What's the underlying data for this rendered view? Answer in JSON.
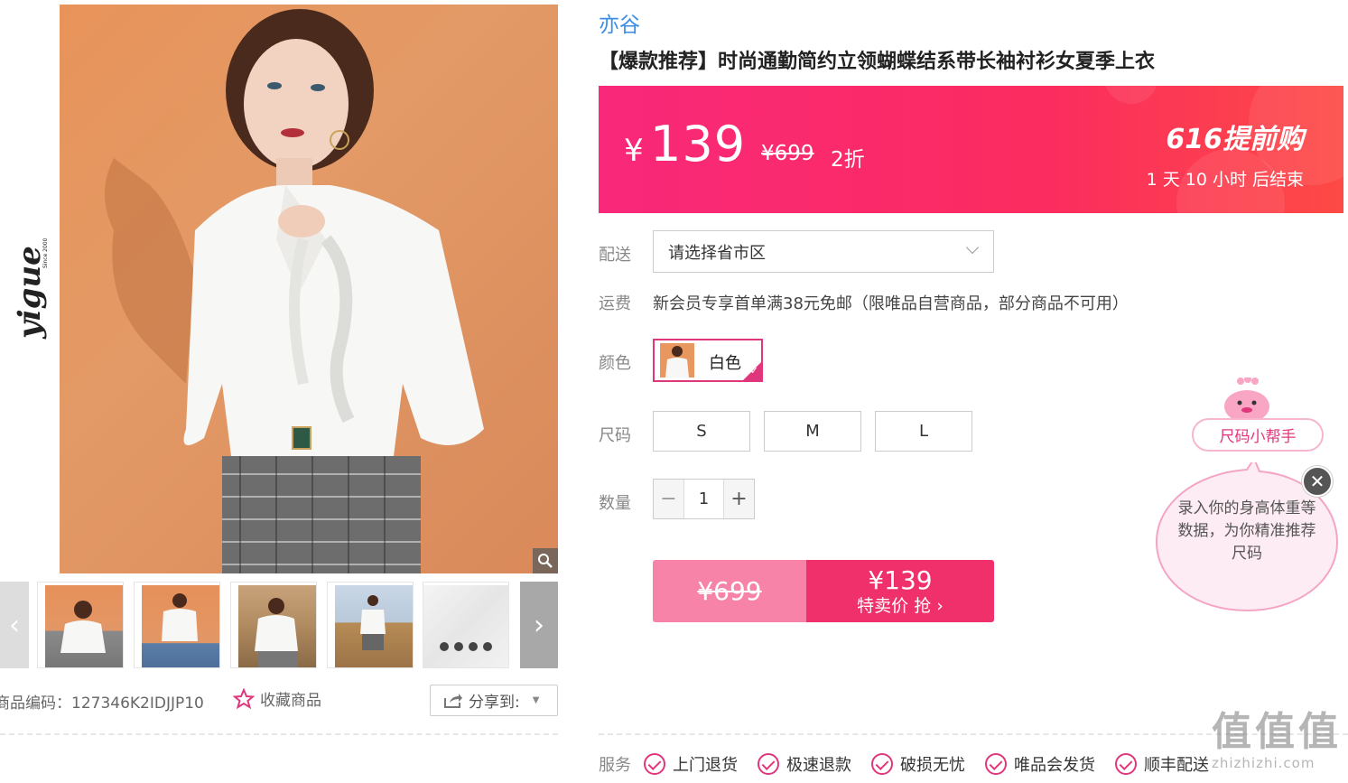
{
  "gallery": {
    "brand_logo_text": "yigue",
    "brand_since": "Since 2000",
    "thumbs": [
      {
        "alt": "front-white-blouse"
      },
      {
        "alt": "front-blouse-jeans"
      },
      {
        "alt": "autumn-field"
      },
      {
        "alt": "field-full"
      },
      {
        "alt": "fabric-detail"
      }
    ],
    "product_code_label": "商品编码：",
    "product_code": "127346K2IDJJP10",
    "favorite_label": "收藏商品",
    "share_label": "分享到:"
  },
  "product": {
    "brand": "亦谷",
    "title": "【爆款推荐】时尚通勤简约立领蝴蝶结系带长袖衬衫女夏季上衣"
  },
  "price_banner": {
    "currency": "¥",
    "price": "139",
    "original": "¥699",
    "discount": "2折",
    "promo_title": "616提前购",
    "countdown": "1 天 10 小时 后结束",
    "colors": {
      "start": "#f9287a",
      "end": "#fd4a45"
    }
  },
  "delivery": {
    "label": "配送",
    "placeholder": "请选择省市区"
  },
  "shipping": {
    "label": "运费",
    "text": "新会员专享首单满38元免邮（限唯品自营商品，部分商品不可用）"
  },
  "color": {
    "label": "颜色",
    "options": [
      {
        "name": "白色",
        "selected": true
      }
    ],
    "accent": "#e0377c"
  },
  "size": {
    "label": "尺码",
    "options": [
      "S",
      "M",
      "L"
    ]
  },
  "quantity": {
    "label": "数量",
    "value": "1",
    "minus": "−",
    "plus": "+"
  },
  "buy": {
    "original": "¥699",
    "price": "¥139",
    "action": "特卖价 抢 ›"
  },
  "size_helper": {
    "tag": "尺码小帮手",
    "bubble_text": "录入你的身高体重等数据，为你精准推荐尺码",
    "close": "✕"
  },
  "services": {
    "label": "服务",
    "items": [
      "上门退货",
      "极速退款",
      "破损无忧",
      "唯品会发货",
      "顺丰配送"
    ]
  },
  "watermark": {
    "big": "值值值",
    "small": "zhizhizhi.com"
  }
}
